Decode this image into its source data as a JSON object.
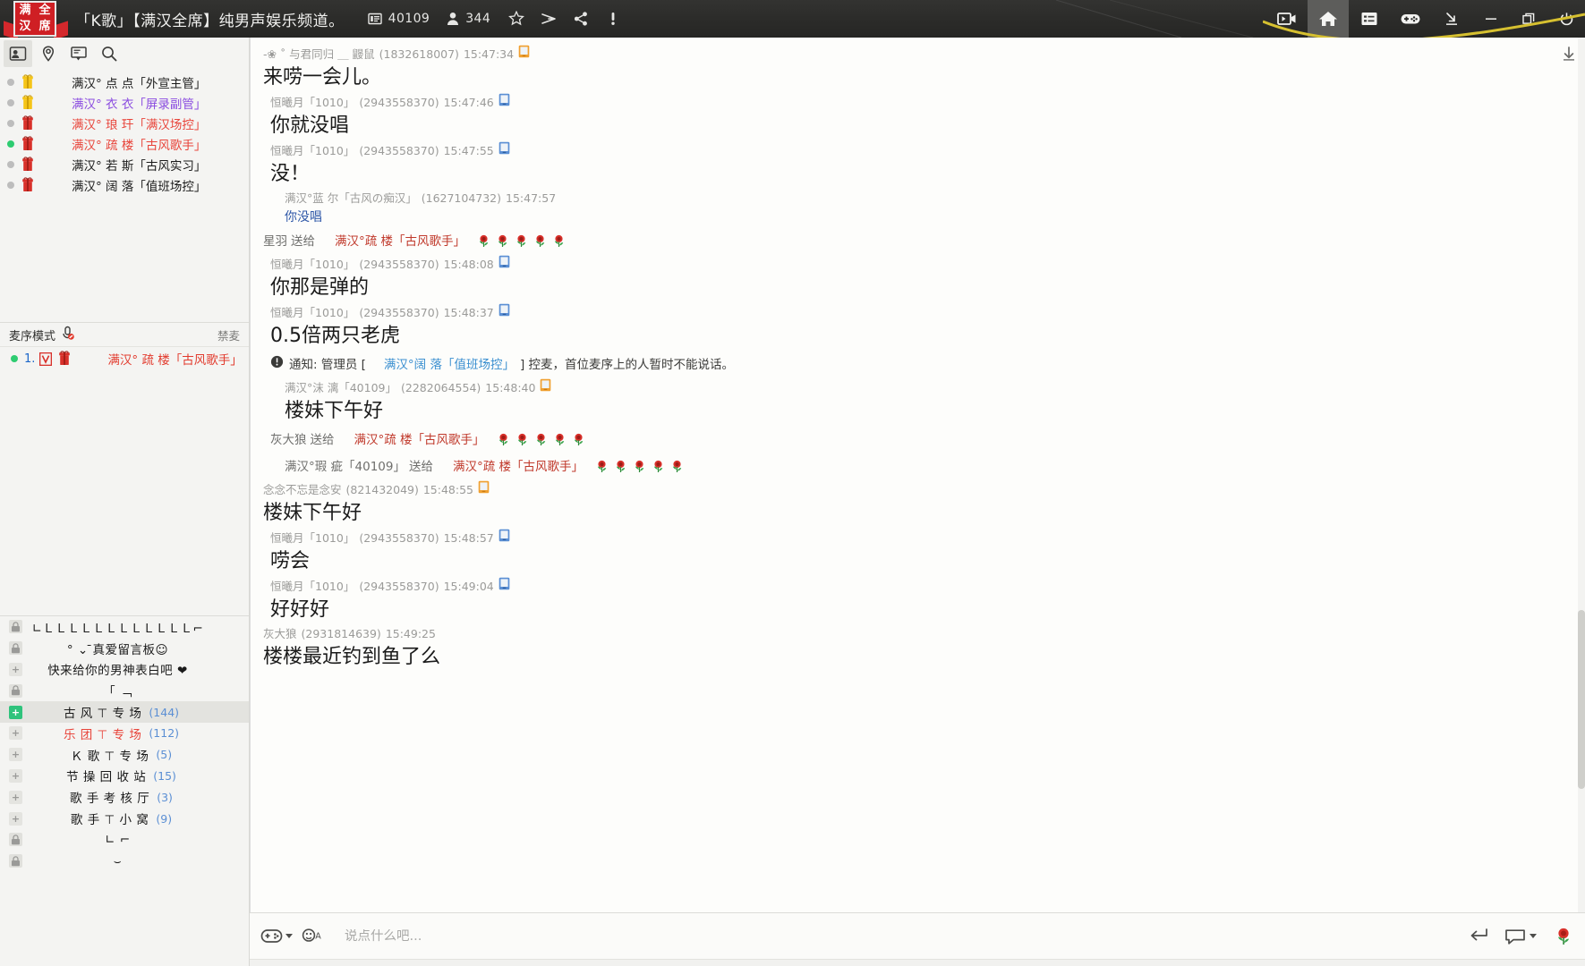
{
  "titlebar": {
    "logo_chars": [
      "满",
      "全",
      "汉",
      "席"
    ],
    "title": "「K歌」【满汉全席】纯男声娱乐频道。",
    "room_id_icon": "id-card-icon",
    "room_id": "40109",
    "member_icon": "person-icon",
    "member_count": "344",
    "actions": [
      "star-icon",
      "broadcast-icon",
      "share-icon",
      "report-icon"
    ],
    "right_buttons": [
      "video-icon",
      "home-icon",
      "list-icon",
      "game-icon",
      "collapse-icon"
    ],
    "window_buttons": [
      "minimize-icon",
      "maximize-icon",
      "power-icon"
    ]
  },
  "left_panel": {
    "tabs": [
      {
        "name": "member-tab",
        "icon": "person-card-icon",
        "active": true
      },
      {
        "name": "location-tab",
        "icon": "location-pin-icon",
        "active": false
      },
      {
        "name": "notice-tab",
        "icon": "board-icon",
        "active": false
      },
      {
        "name": "search-tab",
        "icon": "search-icon",
        "active": false
      }
    ],
    "users": [
      {
        "online": false,
        "badge": "gold-gift",
        "name": "满汉° 点  点「外宣主管」",
        "color": "#1a1a1a"
      },
      {
        "online": false,
        "badge": "gold-gift",
        "name": "满汉° 衣  衣「屏录副管」",
        "color": "#8a4be0"
      },
      {
        "online": false,
        "badge": "red-gift",
        "name": "满汉° 琅  玕「满汉场控」",
        "color": "#e8443a"
      },
      {
        "online": true,
        "badge": "red-gift",
        "name": "满汉° 疏  楼「古风歌手」",
        "color": "#e8443a"
      },
      {
        "online": false,
        "badge": "red-gift",
        "name": "满汉° 若  斯「古风实习」",
        "color": "#1a1a1a"
      },
      {
        "online": false,
        "badge": "red-gift",
        "name": "满汉° 阔  落「值班场控」",
        "color": "#1a1a1a"
      }
    ],
    "mic": {
      "mode_label": "麦序模式",
      "mode_icon": "mic-muted-icon",
      "mute_label": "禁麦",
      "queue": [
        {
          "online": true,
          "index": "1.",
          "v_badge": "v-badge-icon",
          "badge": "red-gift",
          "name": "满汉° 疏  楼「古风歌手」"
        }
      ]
    },
    "rooms": [
      {
        "icon": "lock-icon",
        "label": "∟ＬＬＬＬＬＬＬＬＬＬＬＬ⌐",
        "count": "",
        "color": "#1a1a1a",
        "selected": false,
        "deco": true
      },
      {
        "icon": "lock-icon",
        "label": "° ⌄ ̄真爱留言板☺",
        "count": "",
        "color": "#1a1a1a",
        "selected": false
      },
      {
        "icon": "plus-icon",
        "label": "快来给你的男神表白吧 ❤",
        "count": "",
        "color": "#1a1a1a",
        "selected": false
      },
      {
        "icon": "lock-icon",
        "label": "「                    ﹁",
        "count": "",
        "color": "#1a1a1a",
        "selected": false,
        "deco": true
      },
      {
        "icon": "plus-green-icon",
        "label": "古 风 ⊤ 专 场",
        "count": "(144)",
        "color": "#1a1a1a",
        "selected": true
      },
      {
        "icon": "plus-icon",
        "label": "乐 团 ⊤ 专 场",
        "count": "(112)",
        "color": "#e8443a",
        "selected": false
      },
      {
        "icon": "plus-icon",
        "label": "Ｋ 歌 ⊤ 专 场",
        "count": "(5)",
        "color": "#1a1a1a",
        "selected": false
      },
      {
        "icon": "plus-icon",
        "label": "节 操 回 收 站",
        "count": "(15)",
        "color": "#1a1a1a",
        "selected": false
      },
      {
        "icon": "plus-icon",
        "label": "歌 手 考 核 厅",
        "count": "(3)",
        "color": "#1a1a1a",
        "selected": false
      },
      {
        "icon": "plus-icon",
        "label": "歌 手 ⊤ 小 窝",
        "count": "(9)",
        "color": "#1a1a1a",
        "selected": false
      },
      {
        "icon": "lock-icon",
        "label": "∟                    ⌐",
        "count": "",
        "color": "#1a1a1a",
        "selected": false,
        "deco": true
      },
      {
        "icon": "lock-icon",
        "label": "⌣",
        "count": "",
        "color": "#1a1a1a",
        "selected": false,
        "deco": true
      }
    ]
  },
  "chat": {
    "scroll_to_bottom_icon": "arrow-down-icon",
    "messages": [
      {
        "type": "text",
        "indent": 0,
        "sender": "-❀ ˚ 与君同归 ＿ 鼹鼠",
        "uid": "(1832618007)",
        "time": "15:47:34",
        "device": "orange-phone-icon",
        "text": "来唠一会儿。"
      },
      {
        "type": "text",
        "indent": 1,
        "sender": "恒曦月「1010」",
        "uid": "(2943558370)",
        "time": "15:47:46",
        "device": "blue-phone-icon",
        "text": "你就没唱"
      },
      {
        "type": "text",
        "indent": 1,
        "sender": "恒曦月「1010」",
        "uid": "(2943558370)",
        "time": "15:47:55",
        "device": "blue-phone-icon",
        "text": "没！"
      },
      {
        "type": "small",
        "indent": 2,
        "sender": "满汉°蓝 尔「古风の痴汉」",
        "uid": "(1627104732)",
        "time": "15:47:57",
        "device": "",
        "text": "你没唱"
      },
      {
        "type": "gift",
        "indent": 0,
        "from": "星羽",
        "verb": "送给",
        "to": "满汉°疏  楼「古风歌手」",
        "roses": 5
      },
      {
        "type": "text",
        "indent": 1,
        "sender": "恒曦月「1010」",
        "uid": "(2943558370)",
        "time": "15:48:08",
        "device": "blue-phone-icon",
        "text": "你那是弹的"
      },
      {
        "type": "text",
        "indent": 1,
        "sender": "恒曦月「1010」",
        "uid": "(2943558370)",
        "time": "15:48:37",
        "device": "blue-phone-icon",
        "text": "0.5倍两只老虎"
      },
      {
        "type": "notice",
        "indent": 1,
        "prefix": "通知: 管理员 [",
        "link": "满汉°阔  落「值班场控」",
        "suffix": "] 控麦，首位麦序上的人暂时不能说话。",
        "icon": "exclamation-icon"
      },
      {
        "type": "text",
        "indent": 2,
        "sender": "满汉°沫  漓「40109」",
        "uid": "(2282064554)",
        "time": "15:48:40",
        "device": "orange-phone-icon",
        "text": "楼妹下午好"
      },
      {
        "type": "gift",
        "indent": 1,
        "from": "灰大狼",
        "verb": "送给",
        "to": "满汉°疏  楼「古风歌手」",
        "roses": 5
      },
      {
        "type": "gift",
        "indent": 2,
        "from": "满汉°瑕  疵「40109」",
        "verb": "送给",
        "to": "满汉°疏  楼「古风歌手」",
        "roses": 5
      },
      {
        "type": "text",
        "indent": 0,
        "sender": "念念不忘是念安",
        "uid": "(821432049)",
        "time": "15:48:55",
        "device": "orange-phone-icon",
        "text": "楼妹下午好"
      },
      {
        "type": "text",
        "indent": 1,
        "sender": "恒曦月「1010」",
        "uid": "(2943558370)",
        "time": "15:48:57",
        "device": "blue-phone-icon",
        "text": "唠会"
      },
      {
        "type": "text",
        "indent": 1,
        "sender": "恒曦月「1010」",
        "uid": "(2943558370)",
        "time": "15:49:04",
        "device": "blue-phone-icon",
        "text": "好好好"
      },
      {
        "type": "text",
        "indent": 0,
        "sender": "灰大狼",
        "uid": "(2931814639)",
        "time": "15:49:25",
        "device": "",
        "text": "楼楼最近钓到鱼了么"
      }
    ]
  },
  "input_bar": {
    "emoji_icon": "emoji-face-icon",
    "emoji_caret": "chevron-down-icon",
    "font_icon": "font-color-icon",
    "placeholder": "说点什么吧...",
    "enter_icon": "enter-arrow-icon",
    "chat_icon": "speech-bubble-icon",
    "chat_caret": "chevron-down-icon",
    "avatar_icon": "rose-avatar-icon"
  },
  "colors": {
    "accent_red": "#e8443a",
    "link_blue": "#3a8fd0",
    "count_blue": "#5b8fd4",
    "purple": "#8a4be0",
    "online_green": "#2ecc71",
    "titlebar_bg": "#2b2b29"
  }
}
